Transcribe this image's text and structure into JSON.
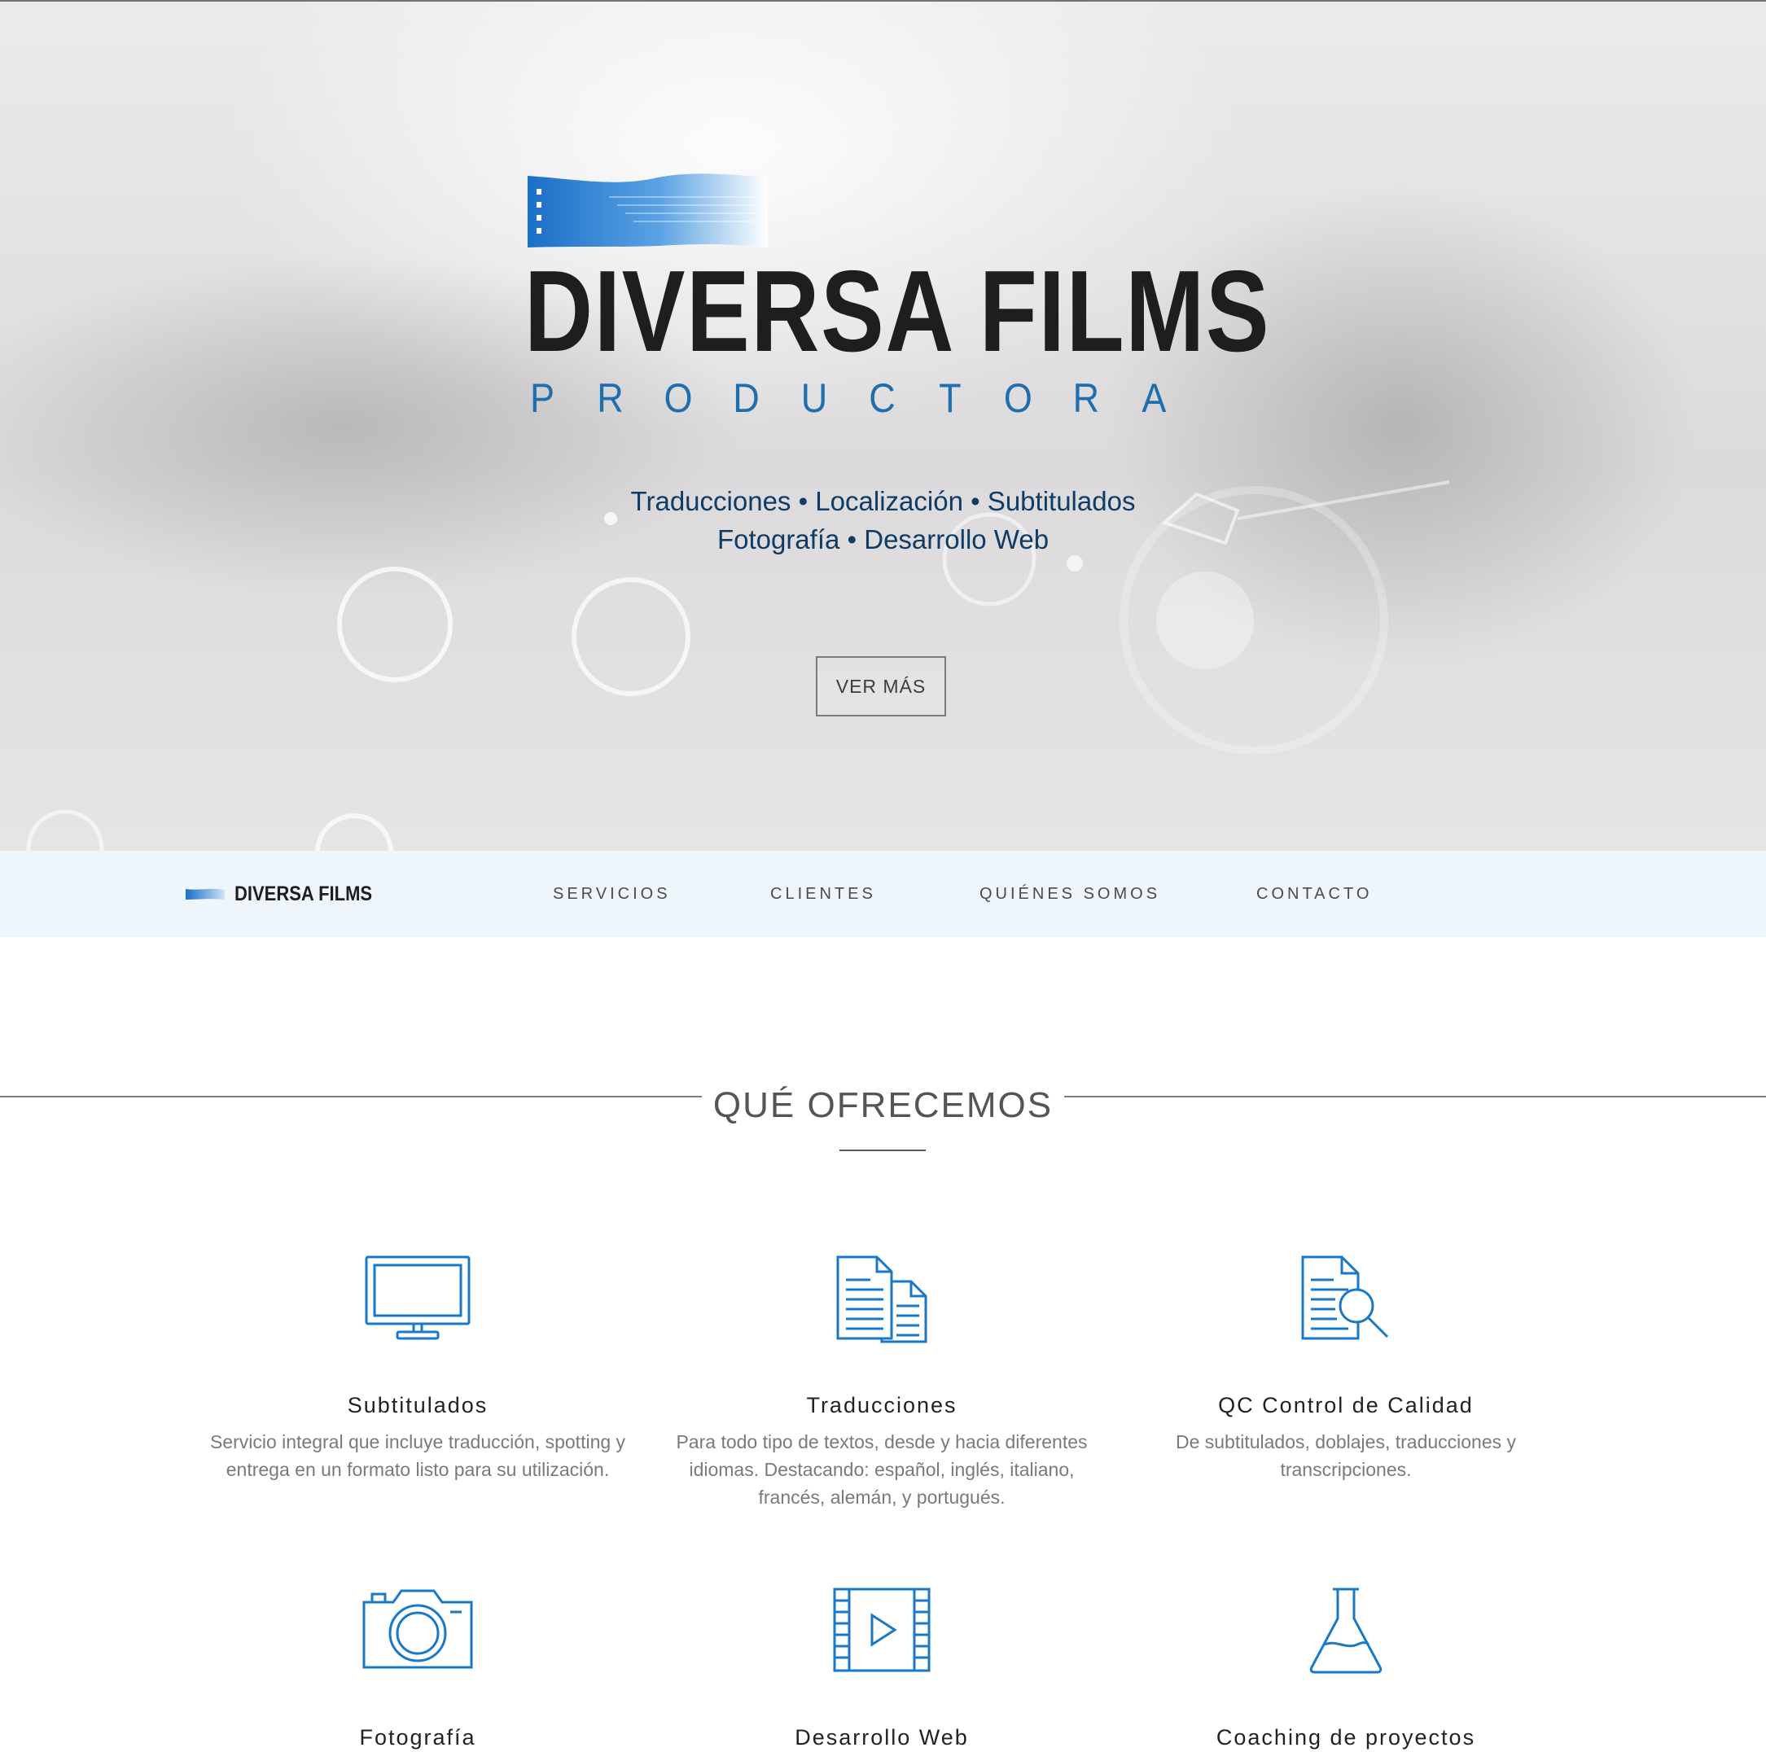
{
  "brand": {
    "name": "DIVERSA FILMS",
    "subtitle_letters": [
      "P",
      "R",
      "O",
      "D",
      "U",
      "C",
      "T",
      "O",
      "R",
      "A"
    ],
    "primary_color": "#1f6fb0",
    "dark_color": "#1e1e1e"
  },
  "hero": {
    "tagline_line1": "Traducciones • Localización • Subtitulados",
    "tagline_line2": "Fotografía • Desarrollo Web",
    "cta_label": "VER MÁS"
  },
  "nav": {
    "logo_text": "DIVERSA FILMS",
    "items": [
      "SERVICIOS",
      "CLIENTES",
      "QUIÉNES SOMOS",
      "CONTACTO"
    ]
  },
  "section": {
    "title": "QUÉ OFRECEMOS"
  },
  "services": [
    {
      "title": "Subtitulados",
      "description": "Servicio integral que incluye traducción, spotting y entrega en un formato listo para su utilización.",
      "icon": "monitor-icon"
    },
    {
      "title": "Traducciones",
      "description": "Para todo tipo de textos, desde y hacia diferentes idiomas. Destacando: español, inglés, italiano, francés, alemán, y portugués.",
      "icon": "documents-icon"
    },
    {
      "title": "QC Control de Calidad",
      "description": "De subtitulados, doblajes, traducciones y transcripciones.",
      "icon": "document-search-icon"
    },
    {
      "title": "Fotografía",
      "description": "",
      "icon": "camera-icon"
    },
    {
      "title": "Desarrollo Web",
      "description": "",
      "icon": "video-film-icon"
    },
    {
      "title": "Coaching de proyectos",
      "description": "",
      "icon": "flask-icon"
    }
  ],
  "icon_color": "#1a78c9"
}
